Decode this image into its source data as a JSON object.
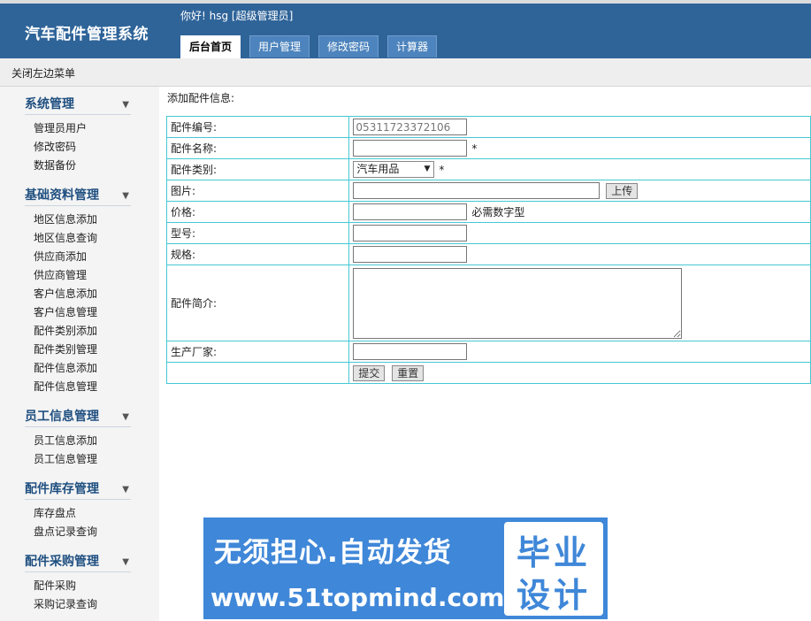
{
  "header": {
    "title": "汽车配件管理系统",
    "greeting": "你好! hsg [超级管理员]",
    "tabs": [
      {
        "label": "后台首页",
        "active": true
      },
      {
        "label": "用户管理",
        "active": false
      },
      {
        "label": "修改密码",
        "active": false
      },
      {
        "label": "计算器",
        "active": false
      }
    ]
  },
  "toolbar": {
    "close_menu": "关闭左边菜单"
  },
  "sidebar": {
    "sections": [
      {
        "title": "系统管理",
        "items": [
          "管理员用户",
          "修改密码",
          "数据备份"
        ]
      },
      {
        "title": "基础资料管理",
        "items": [
          "地区信息添加",
          "地区信息查询",
          "供应商添加",
          "供应商管理",
          "客户信息添加",
          "客户信息管理",
          "配件类别添加",
          "配件类别管理",
          "配件信息添加",
          "配件信息管理"
        ]
      },
      {
        "title": "员工信息管理",
        "items": [
          "员工信息添加",
          "员工信息管理"
        ]
      },
      {
        "title": "配件库存管理",
        "items": [
          "库存盘点",
          "盘点记录查询"
        ]
      },
      {
        "title": "配件采购管理",
        "items": [
          "配件采购",
          "采购记录查询"
        ]
      }
    ]
  },
  "form": {
    "heading": "添加配件信息:",
    "labels": {
      "code": "配件编号:",
      "name": "配件名称:",
      "category": "配件类别:",
      "image": "图片:",
      "price": "价格:",
      "model": "型号:",
      "spec": "规格:",
      "intro": "配件简介:",
      "maker": "生产厂家:"
    },
    "values": {
      "code": "05311723372106",
      "category_selected": "汽车用品"
    },
    "required_mark": "*",
    "price_hint": "必需数字型",
    "upload_button": "上传",
    "submit_button": "提交",
    "reset_button": "重置"
  },
  "banner": {
    "line1": "无须担心.自动发货",
    "line2": "www.51topmind.com",
    "badge_line1": "毕业",
    "badge_line2": "设计"
  },
  "colors": {
    "header_bg": "#2f6499",
    "table_border": "#47c8d3",
    "section_title": "#1f4f80",
    "banner_bg": "#3f87d8"
  }
}
